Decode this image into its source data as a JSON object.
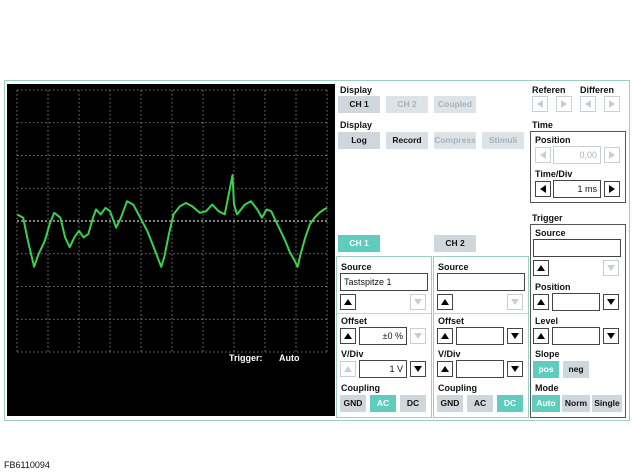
{
  "display": {
    "title": "Display",
    "ch1": "CH 1",
    "ch2": "CH 2",
    "coupled": "Coupled"
  },
  "display2": {
    "title": "Display",
    "log": "Log",
    "record": "Record",
    "compress": "Compress",
    "stimuli": "Stimuli"
  },
  "referen": {
    "title": "Referen"
  },
  "differen": {
    "title": "Differen"
  },
  "time": {
    "title": "Time",
    "position_label": "Position",
    "position_value": "0,00",
    "timediv_label": "Time/Div",
    "timediv_value": "1 ms"
  },
  "scope": {
    "trigger_label": "Trigger:",
    "trigger_mode": "Auto",
    "trace_color": "#39d24a",
    "grid_color": "#9a9a9a"
  },
  "tabs": {
    "ch1": "CH 1",
    "ch2": "CH 2"
  },
  "ch1": {
    "source_label": "Source",
    "source_value": "Tastspitze 1",
    "offset_label": "Offset",
    "offset_value": "±0 %",
    "vdiv_label": "V/Div",
    "vdiv_value": "1 V",
    "coupling_label": "Coupling",
    "gnd": "GND",
    "ac": "AC",
    "dc": "DC",
    "coupling_selected": "AC"
  },
  "ch2": {
    "source_label": "Source",
    "source_value": "",
    "offset_label": "Offset",
    "offset_value": "",
    "vdiv_label": "V/Div",
    "vdiv_value": "",
    "coupling_label": "Coupling",
    "gnd": "GND",
    "ac": "AC",
    "dc": "DC",
    "coupling_selected": "DC"
  },
  "trigger": {
    "title": "Trigger",
    "source_label": "Source",
    "source_value": "",
    "position_label": "Position",
    "level_label": "Level",
    "slope_label": "Slope",
    "pos": "pos",
    "neg": "neg",
    "slope_selected": "pos",
    "mode_label": "Mode",
    "auto": "Auto",
    "norm": "Norm",
    "single": "Single",
    "mode_selected": "Auto"
  },
  "colors": {
    "accent": "#5fcdbd",
    "button": "#cfd6dc",
    "frame": "#9ccfc4"
  },
  "caption": "FB6110094",
  "waveform": [
    [
      0.0,
      0.2
    ],
    [
      0.2,
      0.1
    ],
    [
      0.35,
      -0.6
    ],
    [
      0.55,
      -1.4
    ],
    [
      0.7,
      -1.0
    ],
    [
      0.9,
      -0.6
    ],
    [
      1.05,
      -0.1
    ],
    [
      1.2,
      0.25
    ],
    [
      1.4,
      0.1
    ],
    [
      1.55,
      -0.5
    ],
    [
      1.7,
      -0.8
    ],
    [
      1.85,
      -0.5
    ],
    [
      2.0,
      -0.3
    ],
    [
      2.15,
      -0.5
    ],
    [
      2.3,
      -0.4
    ],
    [
      2.45,
      0.1
    ],
    [
      2.55,
      0.35
    ],
    [
      2.7,
      0.2
    ],
    [
      2.85,
      0.4
    ],
    [
      3.0,
      0.3
    ],
    [
      3.2,
      -0.2
    ],
    [
      3.35,
      0.1
    ],
    [
      3.55,
      0.6
    ],
    [
      3.75,
      0.5
    ],
    [
      3.95,
      0.15
    ],
    [
      4.2,
      -0.3
    ],
    [
      4.45,
      -0.9
    ],
    [
      4.65,
      -1.4
    ],
    [
      4.75,
      -1.1
    ],
    [
      4.9,
      -0.4
    ],
    [
      5.05,
      0.2
    ],
    [
      5.25,
      0.45
    ],
    [
      5.45,
      0.55
    ],
    [
      5.65,
      0.45
    ],
    [
      5.9,
      0.25
    ],
    [
      6.1,
      0.3
    ],
    [
      6.3,
      0.5
    ],
    [
      6.5,
      0.3
    ],
    [
      6.7,
      0.2
    ],
    [
      6.85,
      0.9
    ],
    [
      6.95,
      1.4
    ],
    [
      7.0,
      0.5
    ],
    [
      7.1,
      0.2
    ],
    [
      7.35,
      0.5
    ],
    [
      7.55,
      0.6
    ],
    [
      7.75,
      0.35
    ],
    [
      7.9,
      0.1
    ],
    [
      8.05,
      0.35
    ],
    [
      8.2,
      0.3
    ],
    [
      8.35,
      0.0
    ],
    [
      8.5,
      -0.3
    ],
    [
      8.65,
      -0.6
    ],
    [
      8.8,
      -0.95
    ],
    [
      8.95,
      -1.2
    ],
    [
      9.05,
      -1.4
    ],
    [
      9.15,
      -1.0
    ],
    [
      9.3,
      -0.5
    ],
    [
      9.45,
      -0.1
    ],
    [
      9.6,
      0.1
    ],
    [
      9.75,
      0.25
    ],
    [
      9.9,
      0.35
    ],
    [
      10.0,
      0.4
    ]
  ]
}
